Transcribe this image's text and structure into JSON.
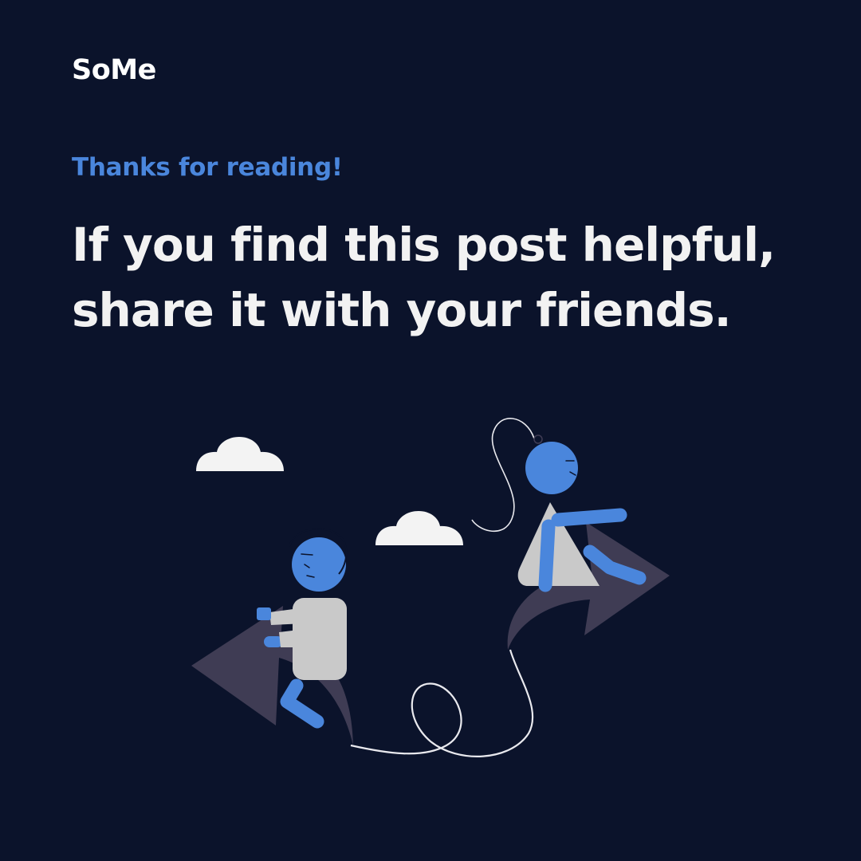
{
  "brand": {
    "name": "SoMe"
  },
  "message": {
    "subtitle": "Thanks for reading!",
    "headline_line1": "If you find this post helpful,",
    "headline_line2": "share it with your friends."
  },
  "colors": {
    "background": "#0b132b",
    "accent": "#4a86dc",
    "text": "#f2f2f2",
    "arrow": "#3f3c54",
    "shirt": "#c9c9c9",
    "cloud": "#f3f3f3"
  },
  "illustration": {
    "scene": "two people riding arrows pointing in opposite directions, linked by a looping string, with clouds"
  }
}
